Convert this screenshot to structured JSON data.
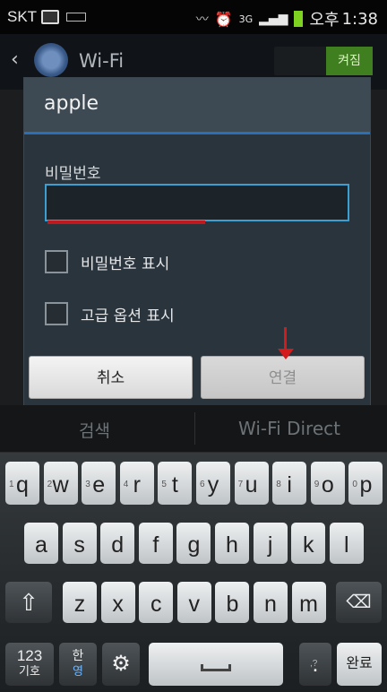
{
  "status_bar": {
    "carrier": "SKT",
    "net": "3G",
    "ampm": "오후",
    "time": "1:38"
  },
  "action_bar": {
    "title": "Wi-Fi",
    "toggle_label": "켜짐"
  },
  "dialog": {
    "title": "apple",
    "password_label": "비밀번호",
    "password_value": "",
    "show_password_label": "비밀번호 표시",
    "advanced_label": "고급 옵션 표시",
    "cancel_label": "취소",
    "connect_label": "연결"
  },
  "bottom_strip": {
    "search_label": "검색",
    "wifi_direct_label": "Wi-Fi Direct"
  },
  "keyboard": {
    "row1": [
      {
        "k": "q",
        "h": "1"
      },
      {
        "k": "w",
        "h": "2"
      },
      {
        "k": "e",
        "h": "3"
      },
      {
        "k": "r",
        "h": "4"
      },
      {
        "k": "t",
        "h": "5"
      },
      {
        "k": "y",
        "h": "6"
      },
      {
        "k": "u",
        "h": "7"
      },
      {
        "k": "i",
        "h": "8"
      },
      {
        "k": "o",
        "h": "9"
      },
      {
        "k": "p",
        "h": "0"
      }
    ],
    "row2": [
      "a",
      "s",
      "d",
      "f",
      "g",
      "h",
      "j",
      "k",
      "l"
    ],
    "row3": [
      "z",
      "x",
      "c",
      "v",
      "b",
      "n",
      "m"
    ],
    "sym_top": "123",
    "sym_bottom": "기호",
    "lang_top": "한",
    "lang_bottom": "영",
    "period_key": ".",
    "period_hint": ",?",
    "done_label": "완료"
  }
}
